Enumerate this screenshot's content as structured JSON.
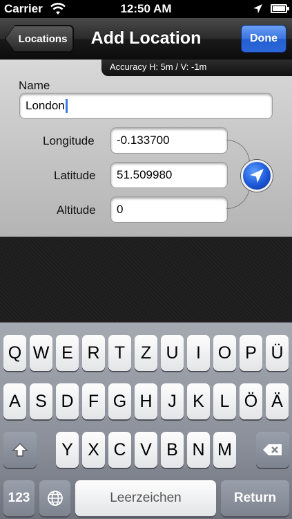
{
  "status_bar": {
    "carrier": "Carrier",
    "time": "12:50 AM"
  },
  "nav": {
    "back_label": "Locations",
    "title": "Add Location",
    "done_label": "Done"
  },
  "accuracy_text": "Accuracy H: 5m / V: -1m",
  "form": {
    "name_label": "Name",
    "name_value": "London",
    "longitude_label": "Longitude",
    "longitude_value": "-0.133700",
    "latitude_label": "Latitude",
    "latitude_value": "51.509980",
    "altitude_label": "Altitude",
    "altitude_value": "0"
  },
  "keyboard": {
    "row1": [
      "Q",
      "W",
      "E",
      "R",
      "T",
      "Z",
      "U",
      "I",
      "O",
      "P",
      "Ü"
    ],
    "row2": [
      "A",
      "S",
      "D",
      "F",
      "G",
      "H",
      "J",
      "K",
      "L",
      "Ö",
      "Ä"
    ],
    "row3": [
      "Y",
      "X",
      "C",
      "V",
      "B",
      "N",
      "M"
    ],
    "num_label": "123",
    "space_label": "Leerzeichen",
    "return_label": "Return"
  },
  "icons": {
    "shift": "shift-icon",
    "backspace": "backspace-icon",
    "globe": "globe-icon",
    "locate": "location-arrow-icon",
    "wifi": "wifi-icon"
  },
  "colors": {
    "accent": "#2b67d8",
    "cursor": "#3d78e0"
  }
}
